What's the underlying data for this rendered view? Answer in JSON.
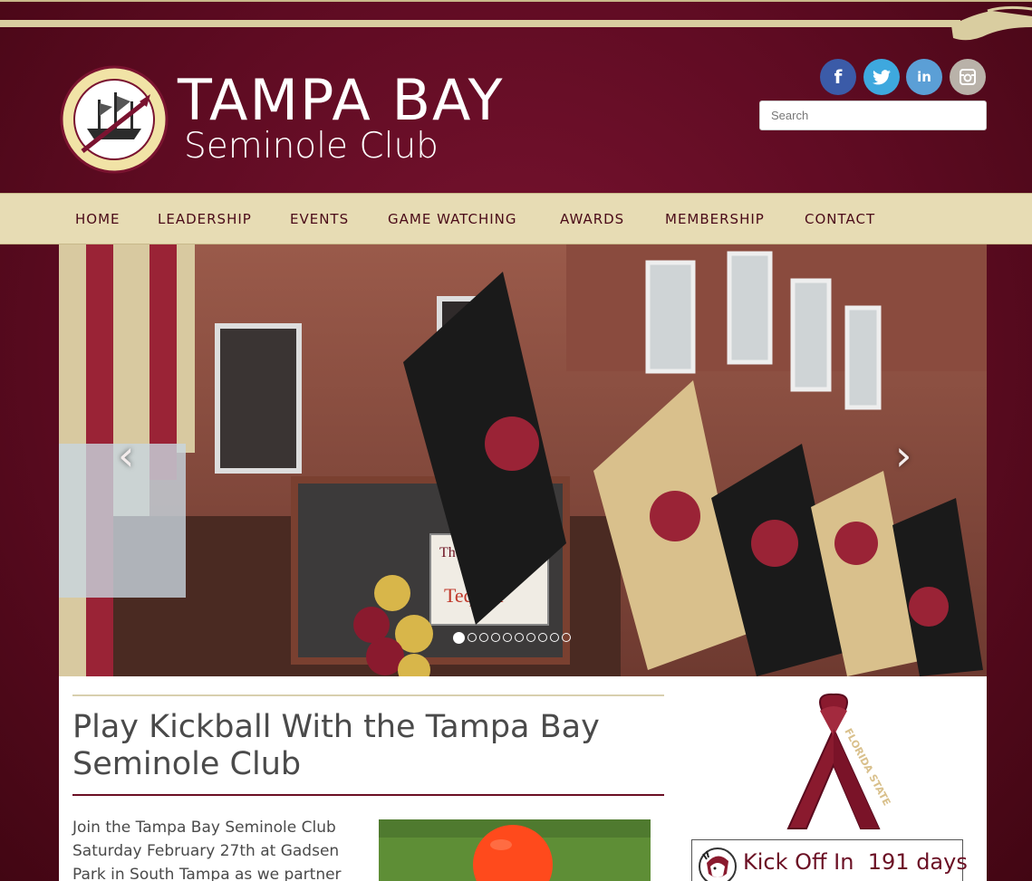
{
  "header": {
    "title": "TAMPA BAY",
    "subtitle": "Seminole Club",
    "logo_text": "TAMPA BAY SEMINOLE CLUB",
    "social": [
      {
        "name": "facebook",
        "glyph": "f",
        "color": "#3b5ba8"
      },
      {
        "name": "twitter",
        "glyph": "t",
        "color": "#3ea8de"
      },
      {
        "name": "linkedin",
        "glyph": "in",
        "color": "#5b9fd6"
      },
      {
        "name": "instagram",
        "glyph": "◎",
        "color": "#b9b2a9"
      }
    ],
    "search_placeholder": "Search"
  },
  "nav": {
    "items": [
      "HOME",
      "LEADERSHIP",
      "EVENTS",
      "GAME WATCHING",
      "AWARDS",
      "MEMBERSHIP",
      "CONTACT"
    ]
  },
  "slider": {
    "prev_glyph": "‹",
    "next_glyph": "›",
    "dot_count": 10,
    "active_index": 0
  },
  "post": {
    "title": "Play Kickball With the Tampa Bay Seminole Club",
    "body": "Join the Tampa Bay Seminole Club Saturday February 27th at Gadsen Park in South Tampa as we partner"
  },
  "sidebar": {
    "ribbon_text": "FLORIDA STATE",
    "countdown_label": "Kick Off In",
    "countdown_value": "191 days"
  },
  "colors": {
    "garnet": "#6b0f24",
    "gold": "#e7dcb4"
  }
}
